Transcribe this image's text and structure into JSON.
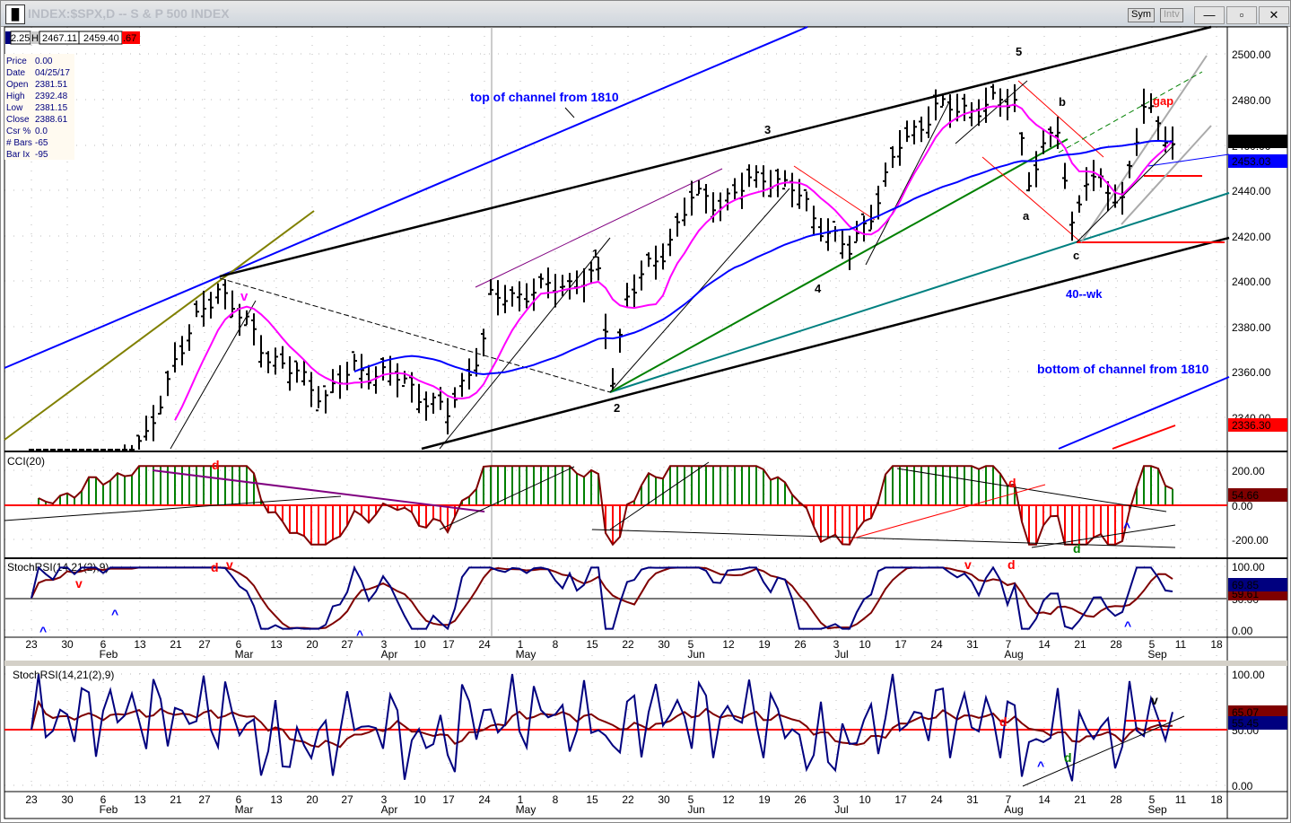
{
  "window": {
    "title": "INDEX:$SPX,D -- S & P 500 INDEX",
    "sym_button": "Sym",
    "intv_button": "Intv",
    "minimize": "—",
    "maximize": "▫",
    "close": "✕"
  },
  "quote_strip": {
    "open": "2.25",
    "h_label": "H",
    "high": "2467.11",
    "low": "2459.40",
    "change": ".67"
  },
  "info_box": [
    {
      "k": "Price",
      "v": "0.00"
    },
    {
      "k": "Date",
      "v": "04/25/17"
    },
    {
      "k": "Open",
      "v": "2381.51"
    },
    {
      "k": "High",
      "v": "2392.48"
    },
    {
      "k": "Low",
      "v": "2381.15"
    },
    {
      "k": "Close",
      "v": "2388.61"
    },
    {
      "k": "Csr %",
      "v": "0.0"
    },
    {
      "k": "# Bars",
      "v": "-65"
    },
    {
      "k": "Bar Ix",
      "v": "-95"
    }
  ],
  "annotations": {
    "top_channel": "top of channel from 1810",
    "bottom_channel": "bottom of channel from 1810",
    "forty_wk": "40--wk",
    "gap": "gap",
    "w1": "1",
    "w2": "2",
    "w3": "3",
    "w4": "4",
    "w5": "5",
    "wa": "a",
    "wb": "b",
    "wc": "c",
    "v_main": "v",
    "cci_d1": "d",
    "cci_d2": "d",
    "cci_d3": "d",
    "cci_up": "^",
    "st_v1": "v",
    "st_d1": "d",
    "st_v2": "v",
    "st_v3": "v",
    "st_d2": "d",
    "st_up1": "^",
    "st_up2": "^",
    "st_up3": "^",
    "st_up4": "^",
    "b_d1": "d",
    "b_d2": "d",
    "b_up": "^",
    "b_v": "v"
  },
  "chart_data": [
    {
      "type": "ohlc",
      "title": "INDEX:$SPX,D",
      "ylim": [
        2330,
        2510
      ],
      "yticks": [
        "2500.00",
        "2480.00",
        "2460.00",
        "2440.00",
        "2420.00",
        "2400.00",
        "2380.00",
        "2360.00",
        "2340.00"
      ],
      "last_labels": [
        {
          "text": "2461.43",
          "color": "#000000"
        },
        {
          "text": "2453.03",
          "color": "#0000ff"
        },
        {
          "text": "2336.30",
          "color": "#ff0000"
        }
      ],
      "close_waypoints": [
        [
          0,
          2290
        ],
        [
          16,
          2330
        ],
        [
          20,
          2366
        ],
        [
          26,
          2398
        ],
        [
          33,
          2368
        ],
        [
          41,
          2350
        ],
        [
          45,
          2362
        ],
        [
          51,
          2358
        ],
        [
          58,
          2342
        ],
        [
          63,
          2374
        ],
        [
          64,
          2392
        ],
        [
          73,
          2398
        ],
        [
          79,
          2402
        ],
        [
          81,
          2358
        ],
        [
          83,
          2394
        ],
        [
          88,
          2413
        ],
        [
          92,
          2437
        ],
        [
          96,
          2435
        ],
        [
          102,
          2447
        ],
        [
          106,
          2441
        ],
        [
          110,
          2425
        ],
        [
          114,
          2413
        ],
        [
          118,
          2437
        ],
        [
          121,
          2460
        ],
        [
          126,
          2476
        ],
        [
          131,
          2476
        ],
        [
          137,
          2480
        ],
        [
          139,
          2445
        ],
        [
          143,
          2468
        ],
        [
          145,
          2425
        ],
        [
          147,
          2445
        ],
        [
          152,
          2437
        ],
        [
          155,
          2476
        ],
        [
          159,
          2462
        ]
      ]
    },
    {
      "type": "histogram",
      "title": "CCI(20)",
      "ylim": [
        -250,
        250
      ],
      "yticks": [
        "200.00",
        "0.00",
        "-200.00"
      ],
      "last": "54.66"
    },
    {
      "type": "line",
      "title": "StochRSI(14,21(2),9)",
      "ylim": [
        0,
        100
      ],
      "yticks": [
        "100.00",
        "50.00",
        "0.00"
      ],
      "last": [
        "69.85",
        "59.61"
      ]
    },
    {
      "type": "line",
      "title": "StochRSI(14,21(2),9)",
      "ylim": [
        0,
        100
      ],
      "yticks": [
        "100.00",
        "50.00",
        "0.00"
      ],
      "last": [
        "65.07",
        "55.45"
      ]
    }
  ],
  "x_axis": {
    "days": [
      "23",
      "30",
      "6",
      "13",
      "21",
      "27",
      "6",
      "13",
      "20",
      "27",
      "3",
      "10",
      "17",
      "24",
      "1",
      "8",
      "15",
      "22",
      "30",
      "5",
      "12",
      "19",
      "26",
      "3",
      "10",
      "17",
      "24",
      "31",
      "7",
      "14",
      "21",
      "28",
      "5",
      "11",
      "18"
    ],
    "months": [
      {
        "label": "Feb",
        "after": 2
      },
      {
        "label": "Mar",
        "after": 6
      },
      {
        "label": "Apr",
        "after": 10
      },
      {
        "label": "May",
        "after": 14
      },
      {
        "label": "Jun",
        "after": 19
      },
      {
        "label": "Jul",
        "after": 23
      },
      {
        "label": "Aug",
        "after": 28
      },
      {
        "label": "Sep",
        "after": 32
      }
    ]
  },
  "colors": {
    "bars": "#000000",
    "ma_fast": "#ff00ff",
    "ma_slow": "#0000ff",
    "cci_up": "#008000",
    "cci_down": "#ff0000",
    "stoch_fast": "#00007f",
    "stoch_slow": "#7f0000",
    "zero": "#ff0000"
  }
}
